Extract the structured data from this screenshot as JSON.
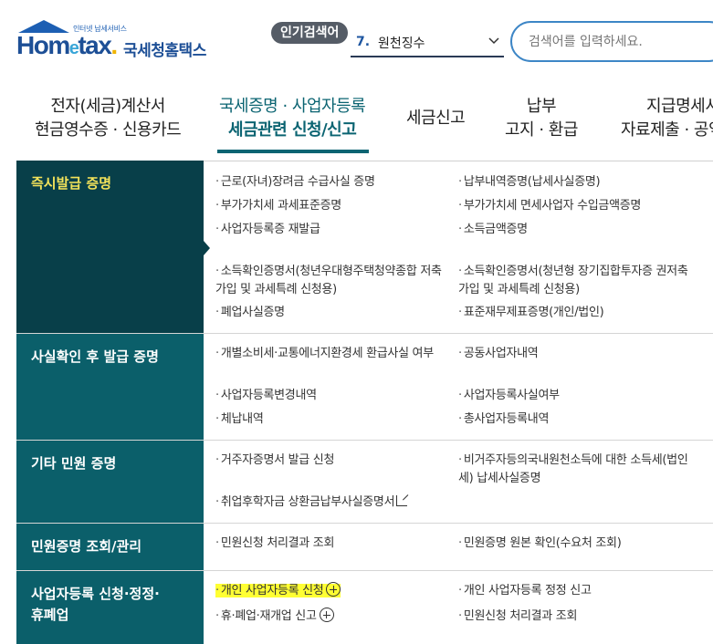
{
  "logo": {
    "sub": "인터넷 납세서비스",
    "brand_pre": "Hom",
    "brand_e": "e",
    "brand_post": "tax",
    "brand_dot": ".",
    "name_ko": "국세청홈택스"
  },
  "popular": {
    "badge": "인기검색어",
    "rank": "7.",
    "keyword": "원천징수"
  },
  "search": {
    "placeholder": "검색어를 입력하세요."
  },
  "nav": [
    {
      "line1": "전자(세금)계산서",
      "line2": "현금영수증 · 신용카드"
    },
    {
      "line1": "국세증명 · 사업자등록",
      "line2": "세금관련 신청/신고",
      "active": true
    },
    {
      "line1": "세금신고",
      "line2": ""
    },
    {
      "line1": "납부",
      "line2": "고지 · 환급"
    },
    {
      "line1": "지급명세서",
      "line2": "자료제출 · 공익"
    }
  ],
  "rows": [
    {
      "category": "즉시발급 증명",
      "active": true,
      "col1": [
        "근로(자녀)장려금 수급사실 증명",
        "부가가치세 과세표준증명",
        "사업자등록증 재발급",
        "소득확인증명서(청년우대형주택청약종합 저축 가입 및 과세특례 신청용)",
        "폐업사실증명"
      ],
      "col2": [
        "납부내역증명(납세사실증명)",
        "부가가치세 면세사업자 수입금액증명",
        "소득금액증명",
        "소득확인증명서(청년형 장기집합투자증 권저축 가입 및 과세특례 신청용)",
        "표준재무제표증명(개인/법인)"
      ]
    },
    {
      "category": "사실확인 후 발급 증명",
      "col1": [
        "개별소비세·교통에너지환경세 환급사실 여부",
        "사업자등록변경내역",
        "체납내역"
      ],
      "col2": [
        "공동사업자내역",
        "사업자등록사실여부",
        "총사업자등록내역"
      ]
    },
    {
      "category": "기타 민원 증명",
      "col1": [
        "거주자증명서 발급 신청",
        "취업후학자금 상환금납부사실증명서"
      ],
      "col2": [
        "비거주자등의국내원천소득에 대한 소득세(법인세) 납세사실증명"
      ]
    },
    {
      "category": "민원증명 조회/관리",
      "col1": [
        "민원신청 처리결과 조회"
      ],
      "col2": [
        "민원증명 원본 확인(수요처 조회)"
      ]
    },
    {
      "category_line1": "사업자등록 신청·정정·",
      "category_line2": "휴폐업",
      "col1": [
        "개인 사업자등록 신청",
        "휴·폐업·재개업 신고"
      ],
      "col2": [
        "개인 사업자등록 정정 신고",
        "민원신청 처리결과 조회"
      ]
    }
  ],
  "colors": {
    "accent": "#0b5f6a",
    "active_cat": "#083f49",
    "active_cat_text": "#f3e35a",
    "highlight": "#ffff33"
  }
}
